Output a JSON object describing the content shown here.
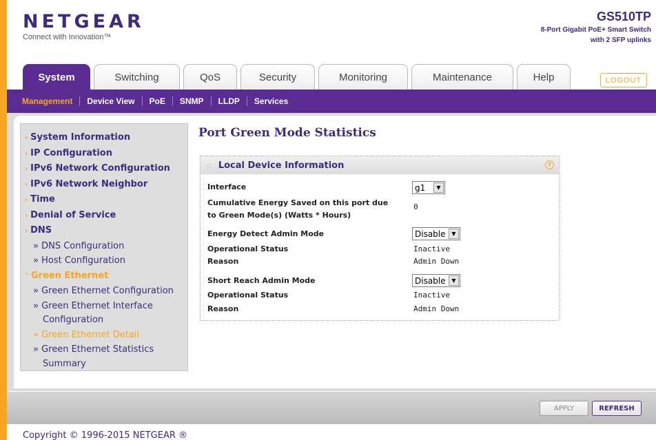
{
  "brand": {
    "logo": "NETGEAR",
    "tagline": "Connect with Innovation™"
  },
  "model": {
    "name": "GS510TP",
    "desc_line1": "8-Port Gigabit PoE+ Smart Switch",
    "desc_line2": "with 2 SFP uplinks"
  },
  "tabs": [
    {
      "label": "System"
    },
    {
      "label": "Switching"
    },
    {
      "label": "QoS"
    },
    {
      "label": "Security"
    },
    {
      "label": "Monitoring"
    },
    {
      "label": "Maintenance"
    },
    {
      "label": "Help"
    }
  ],
  "logout_label": "LOGOUT",
  "subnav": [
    {
      "label": "Management"
    },
    {
      "label": "Device View"
    },
    {
      "label": "PoE"
    },
    {
      "label": "SNMP"
    },
    {
      "label": "LLDP"
    },
    {
      "label": "Services"
    }
  ],
  "sidebar": {
    "items": [
      {
        "label": "System Information"
      },
      {
        "label": "IP Configuration"
      },
      {
        "label": "IPv6 Network Configuration"
      },
      {
        "label": "IPv6 Network Neighbor"
      },
      {
        "label": "Time"
      },
      {
        "label": "Denial of Service"
      },
      {
        "label": "DNS"
      },
      {
        "label": "» DNS Configuration"
      },
      {
        "label": "» Host Configuration"
      },
      {
        "label": "Green Ethernet"
      },
      {
        "label": "» Green Ethernet Configuration"
      },
      {
        "label": "» Green Ethernet Interface"
      },
      {
        "label": "Configuration"
      },
      {
        "label": "» Green Ethernet Detail"
      },
      {
        "label": "» Green Ethernet Statistics"
      },
      {
        "label": "Summary"
      }
    ]
  },
  "main": {
    "title": "Port Green Mode Statistics",
    "panel_title": "Local Device Information",
    "help_glyph": "?",
    "fields": {
      "interface_label": "Interface",
      "interface_value": "g1",
      "cumulative_label_1": "Cumulative Energy Saved on this port due",
      "cumulative_label_2": "to Green Mode(s) (Watts * Hours)",
      "cumulative_value": "0",
      "energy_detect_label": "Energy Detect Admin Mode",
      "energy_detect_value": "Disable",
      "op_status_label_1": "Operational Status",
      "op_status_value_1": "Inactive",
      "reason_label_1": "Reason",
      "reason_value_1": "Admin Down",
      "short_reach_label": "Short Reach Admin Mode",
      "short_reach_value": "Disable",
      "op_status_label_2": "Operational Status",
      "op_status_value_2": "Inactive",
      "reason_label_2": "Reason",
      "reason_value_2": "Admin Down"
    }
  },
  "buttons": {
    "apply": "APPLY",
    "refresh": "REFRESH"
  },
  "copyright": "Copyright © 1996-2015 NETGEAR ®",
  "colors": {
    "brand_purple": "#5a2c91",
    "accent_orange": "#f5a623",
    "text_purple": "#3d2b7c"
  },
  "icons": {
    "dropdown": "triangle-down-icon",
    "help": "help-circle-icon",
    "bullet": "chevron-right-icon"
  }
}
